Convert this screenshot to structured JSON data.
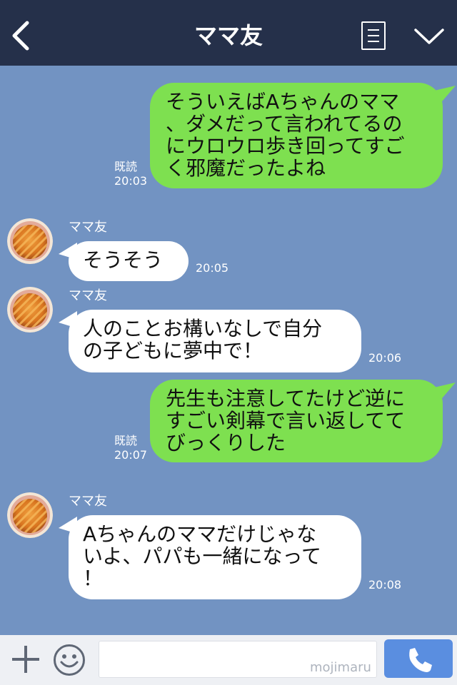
{
  "header": {
    "title": "ママ友"
  },
  "messages": {
    "m1": {
      "text": "そういえばAちゃんのママ\n、ダメだって言われてるの\nにウロウロ歩き回ってすご\nく邪魔だったよね",
      "read": "既読",
      "time": "20:03"
    },
    "m2": {
      "sender": "ママ友",
      "text": "そうそう",
      "time": "20:05"
    },
    "m3": {
      "sender": "ママ友",
      "text": "人のことお構いなしで自分\nの子どもに夢中で！",
      "time": "20:06"
    },
    "m4": {
      "text": "先生も注意してたけど逆に\nすごい剣幕で言い返してて\nびっくりした",
      "read": "既読",
      "time": "20:07"
    },
    "m5": {
      "sender": "ママ友",
      "text": "Aちゃんのママだけじゃな\nいよ、パパも一緒になって\n！",
      "time": "20:08"
    }
  },
  "input": {
    "value": "",
    "placeholder": ""
  },
  "watermark": "mojimaru",
  "colors": {
    "header": "#25304a",
    "chat_bg": "#7293c2",
    "sent": "#7ee050",
    "received": "#ffffff",
    "call": "#5a8ee0"
  }
}
